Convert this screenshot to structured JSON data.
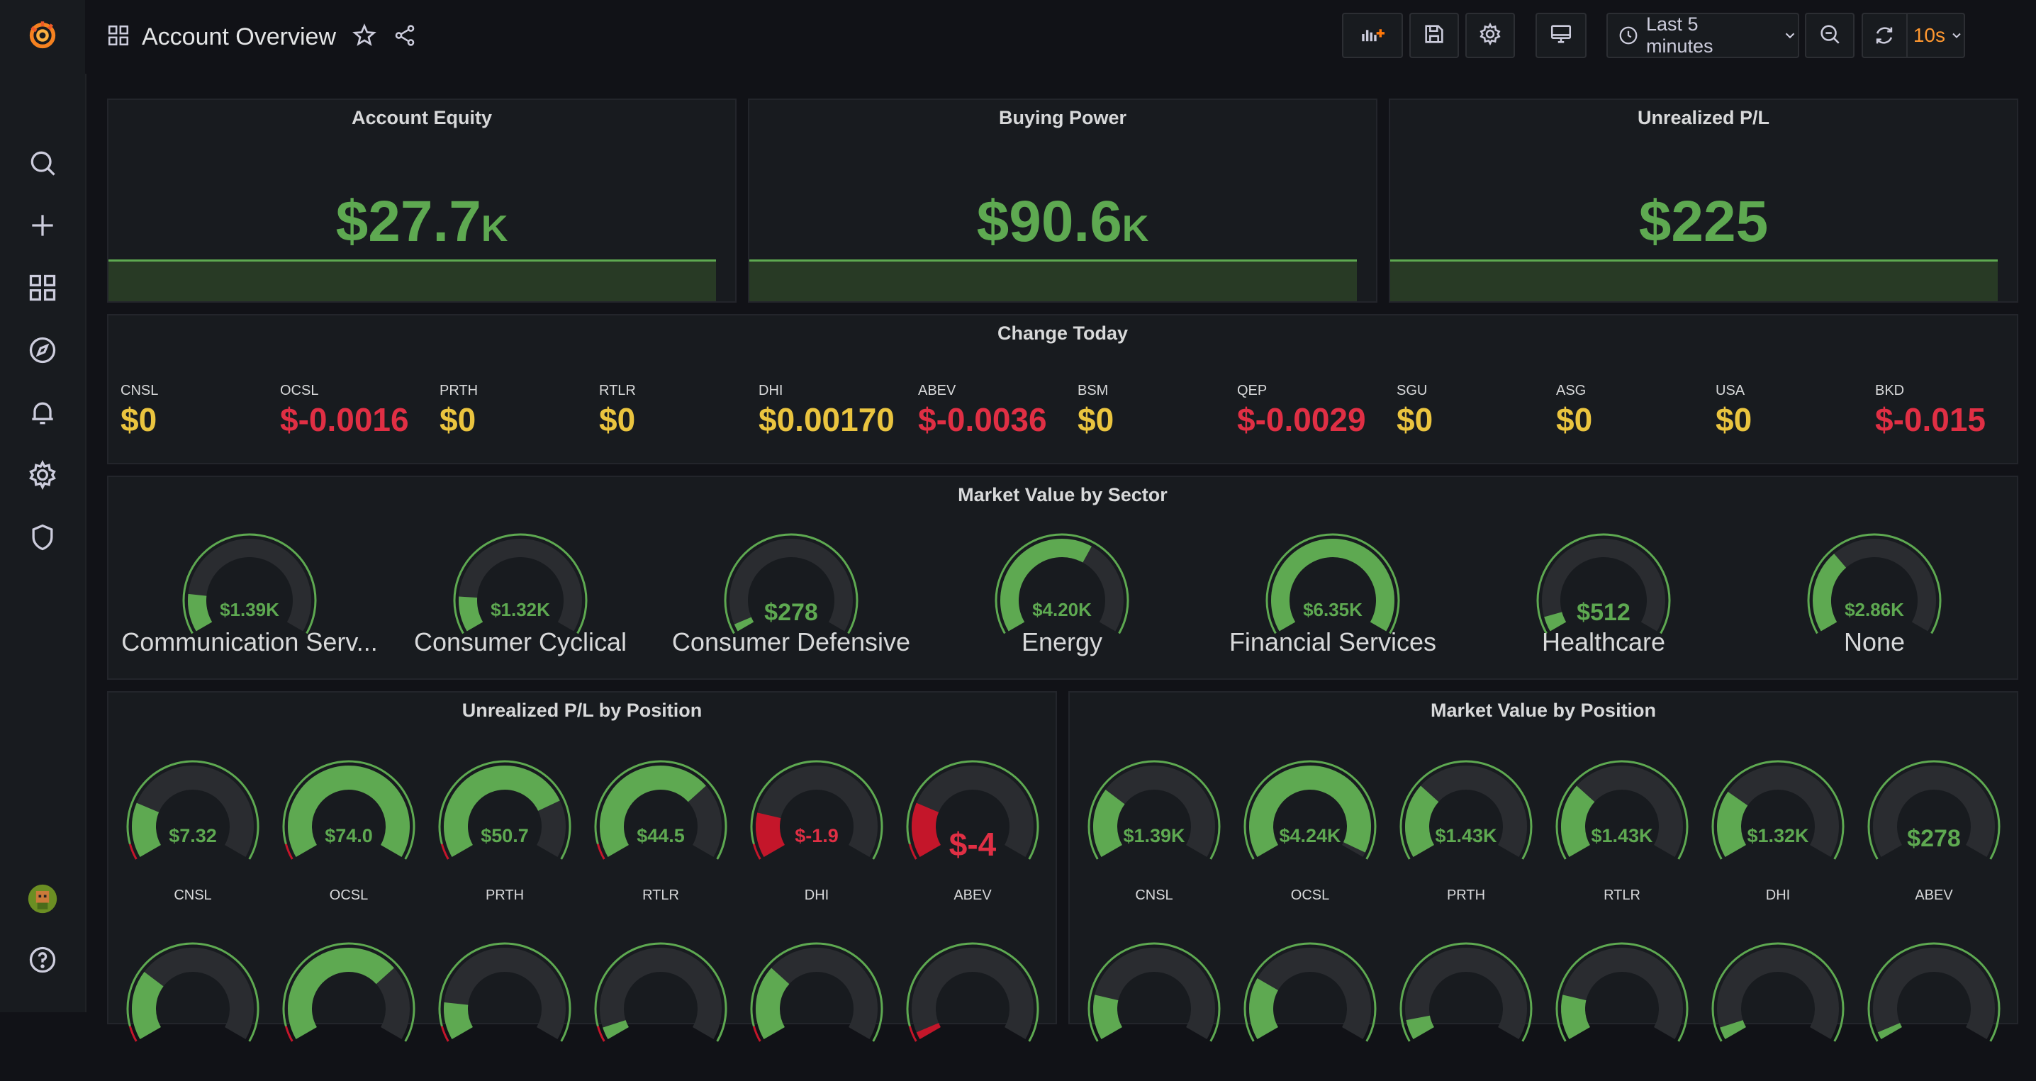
{
  "app": {
    "title": "Account Overview"
  },
  "toolbar": {
    "time_range": "Last 5 minutes",
    "refresh_interval": "10s"
  },
  "colors": {
    "green": "#5ea951",
    "yellow": "#eac43f",
    "red": "#e02f44",
    "dark_red": "#c4162a",
    "bg": "#111217",
    "panel": "#181b1f",
    "orange": "#ff780a"
  },
  "stats": [
    {
      "title": "Account Equity",
      "value": "$27.7",
      "unit": "K"
    },
    {
      "title": "Buying Power",
      "value": "$90.6",
      "unit": "K"
    },
    {
      "title": "Unrealized P/L",
      "value": "$225",
      "unit": ""
    }
  ],
  "change_today": {
    "title": "Change Today",
    "items": [
      {
        "symbol": "CNSL",
        "value": "$0",
        "status": "neutral"
      },
      {
        "symbol": "OCSL",
        "value": "$-0.0016",
        "status": "negative"
      },
      {
        "symbol": "PRTH",
        "value": "$0",
        "status": "neutral"
      },
      {
        "symbol": "RTLR",
        "value": "$0",
        "status": "neutral"
      },
      {
        "symbol": "DHI",
        "value": "$0.00170",
        "status": "neutral"
      },
      {
        "symbol": "ABEV",
        "value": "$-0.0036",
        "status": "negative"
      },
      {
        "symbol": "BSM",
        "value": "$0",
        "status": "neutral"
      },
      {
        "symbol": "QEP",
        "value": "$-0.0029",
        "status": "negative"
      },
      {
        "symbol": "SGU",
        "value": "$0",
        "status": "neutral"
      },
      {
        "symbol": "ASG",
        "value": "$0",
        "status": "neutral"
      },
      {
        "symbol": "USA",
        "value": "$0",
        "status": "neutral"
      },
      {
        "symbol": "BKD",
        "value": "$-0.015",
        "status": "negative"
      }
    ]
  },
  "sector": {
    "title": "Market Value by Sector",
    "gauges": [
      {
        "label": "Communication Serv...",
        "value": "$1.39K",
        "fill": 0.15
      },
      {
        "label": "Consumer Cyclical",
        "value": "$1.32K",
        "fill": 0.14
      },
      {
        "label": "Consumer Defensive",
        "value": "$278",
        "fill": 0.03
      },
      {
        "label": "Energy",
        "value": "$4.20K",
        "fill": 0.62
      },
      {
        "label": "Financial Services",
        "value": "$6.35K",
        "fill": 1.0
      },
      {
        "label": "Healthcare",
        "value": "$512",
        "fill": 0.06
      },
      {
        "label": "None",
        "value": "$2.86K",
        "fill": 0.33
      }
    ]
  },
  "pl_position": {
    "title": "Unrealized P/L by Position",
    "gauges": [
      {
        "label": "CNSL",
        "value": "$7.32",
        "fill": 0.22,
        "negative": false
      },
      {
        "label": "OCSL",
        "value": "$74.0",
        "fill": 1.0,
        "negative": false
      },
      {
        "label": "PRTH",
        "value": "$50.7",
        "fill": 0.77,
        "negative": false
      },
      {
        "label": "RTLR",
        "value": "$44.5",
        "fill": 0.7,
        "negative": false
      },
      {
        "label": "DHI",
        "value": "$-1.9",
        "fill": 0.18,
        "negative": true
      },
      {
        "label": "ABEV",
        "value": "$-4",
        "fill": 0.22,
        "negative": true
      }
    ]
  },
  "mv_position": {
    "title": "Market Value by Position",
    "gauges": [
      {
        "label": "CNSL",
        "value": "$1.39K",
        "fill": 0.28
      },
      {
        "label": "OCSL",
        "value": "$4.24K",
        "fill": 0.98
      },
      {
        "label": "PRTH",
        "value": "$1.43K",
        "fill": 0.3
      },
      {
        "label": "RTLR",
        "value": "$1.43K",
        "fill": 0.3
      },
      {
        "label": "DHI",
        "value": "$1.32K",
        "fill": 0.27
      },
      {
        "label": "ABEV",
        "value": "$278",
        "fill": 0.0
      }
    ]
  },
  "pl_position_row2": [
    {
      "fill": 0.28,
      "negative": false
    },
    {
      "fill": 0.7,
      "negative": false
    },
    {
      "fill": 0.15,
      "negative": false
    },
    {
      "fill": 0.05,
      "negative": false
    },
    {
      "fill": 0.3,
      "negative": false
    },
    {
      "fill": 0.03,
      "negative": true
    }
  ],
  "mv_position_row2": [
    {
      "fill": 0.18
    },
    {
      "fill": 0.25
    },
    {
      "fill": 0.08
    },
    {
      "fill": 0.18
    },
    {
      "fill": 0.05
    },
    {
      "fill": 0.03
    }
  ]
}
